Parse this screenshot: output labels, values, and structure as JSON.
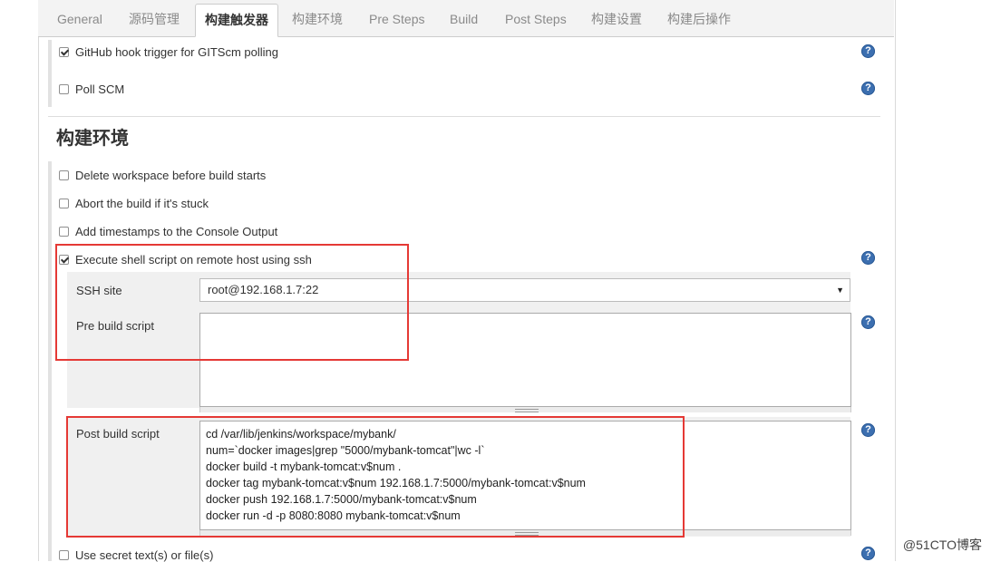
{
  "tabs": [
    {
      "label": "General"
    },
    {
      "label": "源码管理"
    },
    {
      "label": "构建触发器"
    },
    {
      "label": "构建环境"
    },
    {
      "label": "Pre Steps"
    },
    {
      "label": "Build"
    },
    {
      "label": "Post Steps"
    },
    {
      "label": "构建设置"
    },
    {
      "label": "构建后操作"
    }
  ],
  "triggers": {
    "github_hook": {
      "label": "GitHub hook trigger for GITScm polling",
      "checked": true
    },
    "poll_scm": {
      "label": "Poll SCM",
      "checked": false
    }
  },
  "build_env": {
    "heading": "构建环境",
    "delete_ws": {
      "label": "Delete workspace before build starts",
      "checked": false
    },
    "abort": {
      "label": "Abort the build if it's stuck",
      "checked": false
    },
    "timestamps": {
      "label": "Add timestamps to the Console Output",
      "checked": false
    },
    "ssh": {
      "label": "Execute shell script on remote host using ssh",
      "checked": true
    },
    "ssh_site_label": "SSH site",
    "ssh_site_value": "root@192.168.1.7:22",
    "pre_build_label": "Pre build script",
    "pre_build_value": "",
    "post_build_label": "Post build script",
    "post_build_value": "cd /var/lib/jenkins/workspace/mybank/\nnum=`docker images|grep \"5000/mybank-tomcat\"|wc -l`\ndocker build -t mybank-tomcat:v$num .\ndocker tag mybank-tomcat:v$num 192.168.1.7:5000/mybank-tomcat:v$num\ndocker push 192.168.1.7:5000/mybank-tomcat:v$num\ndocker run -d -p 8080:8080 mybank-tomcat:v$num",
    "secret": {
      "label": "Use secret text(s) or file(s)",
      "checked": false
    }
  },
  "help_glyph": "?",
  "select_arrow": "▼",
  "watermark": "@51CTO博客",
  "colors": {
    "highlight": "#e53935",
    "help": "#3c6fb0"
  }
}
